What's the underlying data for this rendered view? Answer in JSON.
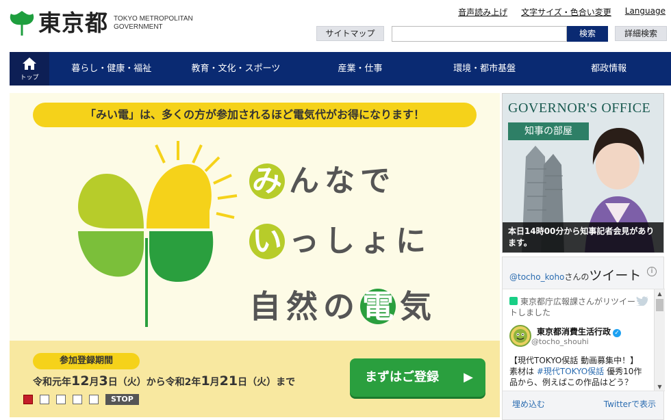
{
  "header": {
    "logo_text": "東京都",
    "logo_sub_line1": "TOKYO METROPOLITAN",
    "logo_sub_line2": "GOVERNMENT",
    "top_links": [
      "音声読み上げ",
      "文字サイズ・色合い変更",
      "Language"
    ],
    "sitemap_label": "サイトマップ",
    "search_placeholder": "",
    "search_label": "検索",
    "advanced_search_label": "詳細検索"
  },
  "nav": {
    "home_label": "トップ",
    "items": [
      "暮らし・健康・福祉",
      "教育・文化・スポーツ",
      "産業・仕事",
      "環境・都市基盤",
      "都政情報"
    ]
  },
  "banner": {
    "ribbon_text": "「みい電」は、多くの方が参加されるほど電気代がお得になります！",
    "line1_first": "み",
    "line1_rest": "んなで",
    "line2_first": "い",
    "line2_rest": "っしょに",
    "line3_a": "自然の",
    "line3_circle": "電",
    "line3_b": "気",
    "period_label": "参加登録期間",
    "period_p1": "令和元年",
    "period_n1": "12",
    "period_p2": "月",
    "period_n2": "3",
    "period_p3": "日（火）から令和2年",
    "period_n3": "1",
    "period_p4": "月",
    "period_n4": "21",
    "period_p5": "日（火）まで",
    "cta_label": "まずはご登録",
    "cta_arrow": "▶",
    "stop_label": "STOP",
    "slide_count": 5,
    "active_slide": 1
  },
  "governor": {
    "title": "GOVERNOR'S OFFICE",
    "badge": "知事の部屋",
    "caption": "本日14時00分から知事記者会見があります。"
  },
  "twitter": {
    "handle": "@tocho_koho",
    "handle_suffix": "さんの",
    "heading": "ツイート",
    "info": "i",
    "retweet_text": "東京都庁広報課さんがリツイートしました",
    "author_name": "東京都消費生活行政",
    "author_handle": "@tocho_shouhi",
    "tweet_line1": "【現代TOKYO㑨話 動画募集中！】",
    "tweet_pre": "素材は",
    "tweet_tag": "#現代TOKYO㑨話",
    "tweet_post": "優秀10作品から、例えばこの作品はどう？",
    "embed_label": "埋め込む",
    "view_label": "Twitterで表示"
  },
  "colors": {
    "navy": "#0a2a72",
    "logo_green": "#1e9e3e",
    "ribbon_yellow": "#f5d21a",
    "cta_green": "#2a9f3e"
  }
}
